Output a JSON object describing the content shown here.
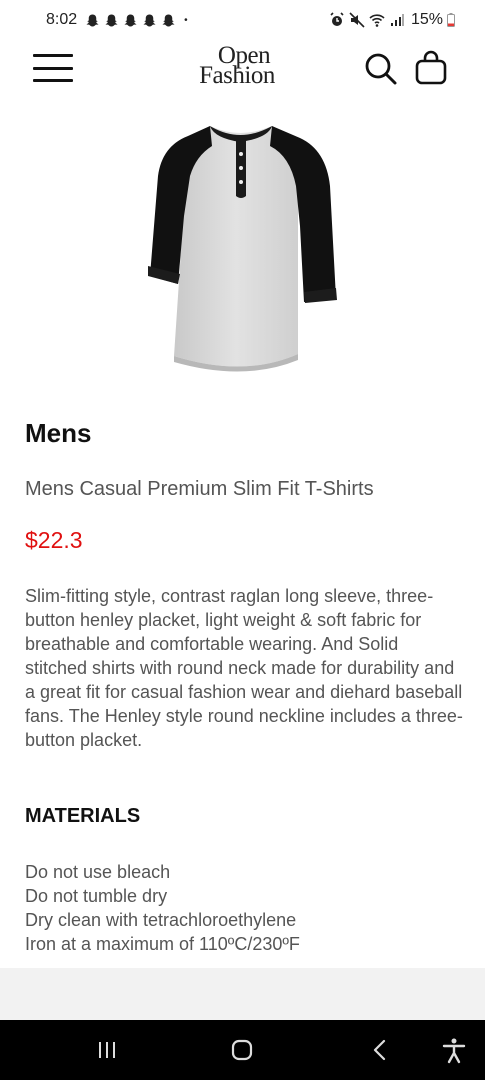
{
  "status_bar": {
    "time": "8:02",
    "battery": "15%",
    "notification_icons": [
      "snapchat-icon",
      "snapchat-icon",
      "snapchat-icon",
      "snapchat-icon",
      "snapchat-icon"
    ],
    "dot": "•"
  },
  "header": {
    "logo_line1": "Open",
    "logo_line2": "Fashion"
  },
  "product": {
    "category": "Mens",
    "title": "Mens Casual Premium Slim Fit T-Shirts",
    "price": "$22.3",
    "description": "Slim-fitting style, contrast raglan long sleeve, three-button henley placket, light weight & soft fabric for breathable and comfortable wearing. And Solid stitched shirts with round neck made for durability and a great fit for casual fashion wear and diehard baseball fans. The Henley style round neckline includes a three-button placket."
  },
  "materials": {
    "heading": "MATERIALS",
    "items": [
      "Do not use bleach",
      "Do not tumble dry",
      "Dry clean with tetrachloroethylene",
      "Iron at a maximum of 110ºC/230ºF"
    ]
  },
  "colors": {
    "price": "#e01010",
    "nav_bar": "#000000",
    "footer": "#f2f2f2"
  }
}
